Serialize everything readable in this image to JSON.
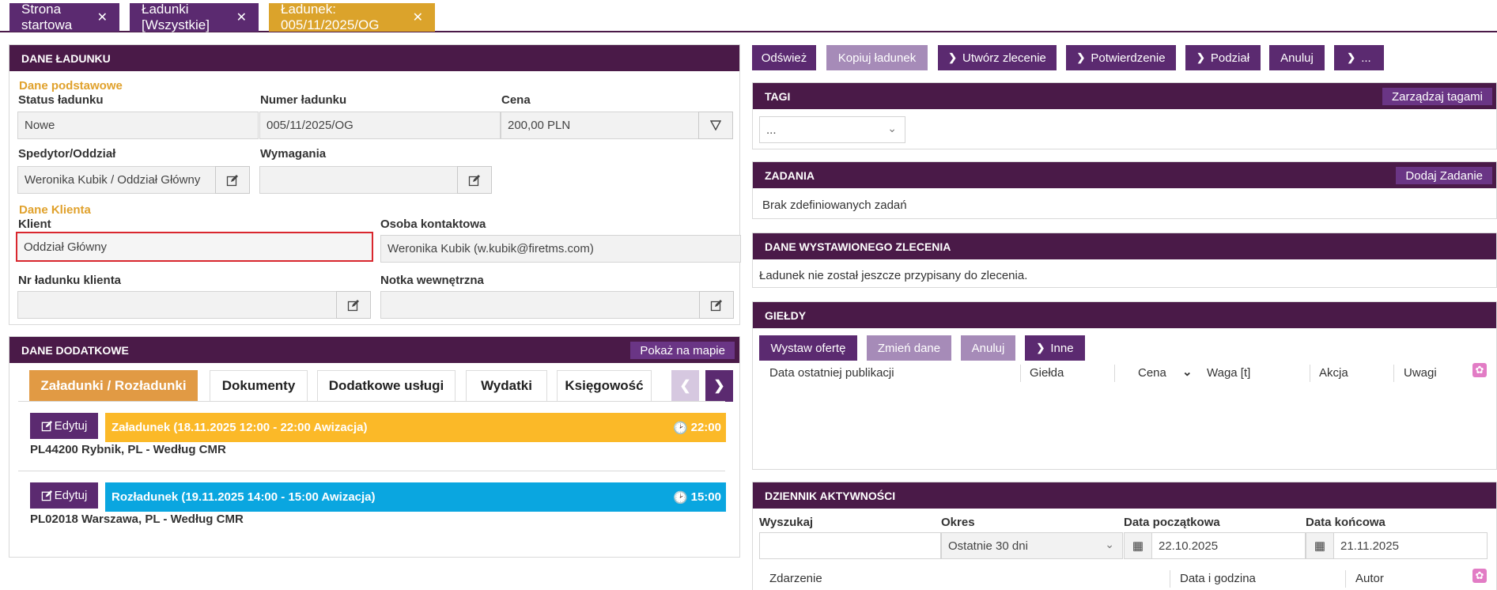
{
  "tabs": [
    {
      "label": "Strona startowa"
    },
    {
      "label": "Ładunki [Wszystkie]"
    },
    {
      "label": "Ładunek: 005/11/2025/OG"
    }
  ],
  "dane_ladunku": {
    "title": "DANE ŁADUNKU",
    "section_basic": "Dane podstawowe",
    "status_label": "Status ładunku",
    "status_value": "Nowe",
    "number_label": "Numer ładunku",
    "number_value": "005/11/2025/OG",
    "price_label": "Cena",
    "price_value": "200,00 PLN",
    "forwarder_label": "Spedytor/Oddział",
    "forwarder_value": "Weronika Kubik / Oddział Główny",
    "requirements_label": "Wymagania",
    "requirements_value": "",
    "section_client": "Dane Klienta",
    "client_label": "Klient",
    "client_value": "Oddział Główny",
    "contact_label": "Osoba kontaktowa",
    "contact_value": "Weronika Kubik (w.kubik@firetms.com)",
    "client_load_no_label": "Nr ładunku klienta",
    "client_load_no_value": "",
    "internal_note_label": "Notka wewnętrzna",
    "internal_note_value": ""
  },
  "dane_dodatkowe": {
    "title": "DANE DODATKOWE",
    "map_button": "Pokaż na mapie",
    "subtabs": [
      "Załadunki / Rozładunki",
      "Dokumenty",
      "Dodatkowe usługi",
      "Wydatki",
      "Księgowość"
    ],
    "stops": [
      {
        "edit": "Edytuj",
        "title": "Załadunek (18.11.2025 12:00 - 22:00 Awizacja)",
        "time": "22:00",
        "address": "PL44200 Rybnik, PL - Według CMR",
        "color": "#fbb928"
      },
      {
        "edit": "Edytuj",
        "title": "Rozładunek (19.11.2025 14:00 - 15:00 Awizacja)",
        "time": "15:00",
        "address": "PL02018 Warszawa, PL - Według CMR",
        "color": "#0aa6e0"
      }
    ]
  },
  "toolbar": {
    "refresh": "Odśwież",
    "copy": "Kopiuj ładunek",
    "create_order": "Utwórz zlecenie",
    "confirmation": "Potwierdzenie",
    "split": "Podział",
    "cancel": "Anuluj",
    "more": "..."
  },
  "tagi": {
    "title": "TAGI",
    "manage": "Zarządzaj tagami",
    "select_value": "..."
  },
  "zadania": {
    "title": "ZADANIA",
    "add": "Dodaj Zadanie",
    "empty": "Brak zdefiniowanych zadań"
  },
  "zlecenie": {
    "title": "DANE WYSTAWIONEGO ZLECENIA",
    "text": "Ładunek nie został jeszcze przypisany do zlecenia."
  },
  "gieldy": {
    "title": "GIEŁDY",
    "offer": "Wystaw ofertę",
    "change": "Zmień dane",
    "cancel": "Anuluj",
    "other": "Inne",
    "columns": [
      "Data ostatniej publikacji",
      "Giełda",
      "Cena",
      "Waga [t]",
      "Akcja",
      "Uwagi"
    ]
  },
  "dziennik": {
    "title": "DZIENNIK AKTYWNOŚCI",
    "search_label": "Wyszukaj",
    "search_value": "",
    "period_label": "Okres",
    "period_value": "Ostatnie 30 dni",
    "start_label": "Data początkowa",
    "start_value": "22.10.2025",
    "end_label": "Data końcowa",
    "end_value": "21.11.2025",
    "columns": [
      "Zdarzenie",
      "Data i godzina",
      "Autor"
    ]
  },
  "colors": {
    "header": "#4a1a48",
    "button": "#5b2a70",
    "accent": "#e0a12c",
    "highlight": "#d9272e"
  },
  "icons": [
    "close-icon",
    "edit-icon",
    "funnel-icon",
    "chevron-down-icon",
    "chevron-left-icon",
    "chevron-right-icon",
    "clock-icon",
    "calendar-icon",
    "gear-icon"
  ]
}
